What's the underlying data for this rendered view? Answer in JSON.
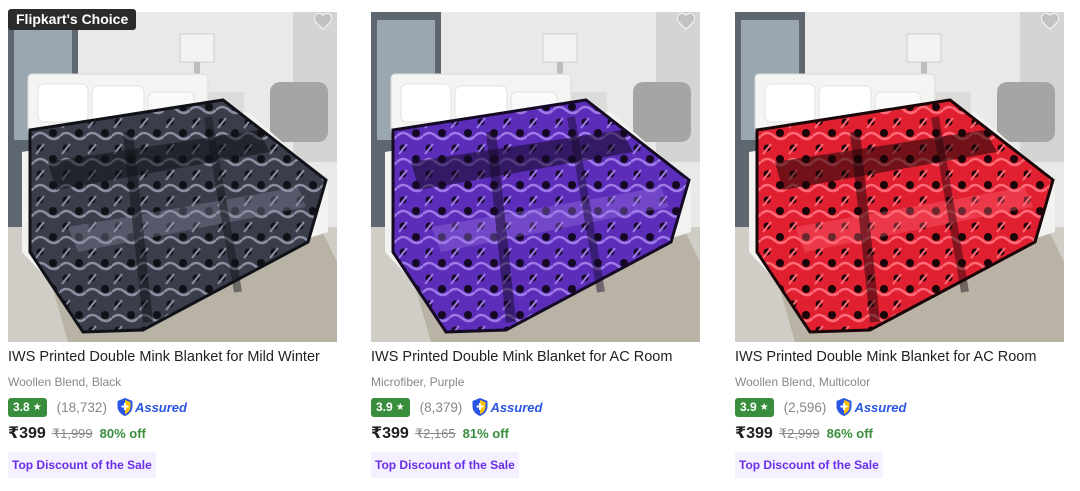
{
  "products": [
    {
      "badge": "Flipkart's Choice",
      "title": "IWS Printed Double Mink Blanket for Mild Winter",
      "subtitle": "Woollen Blend, Black",
      "rating": "3.8",
      "rating_star": "★",
      "rating_count": "(18,732)",
      "assured_label": "Assured",
      "price": "₹399",
      "mrp": "₹1,999",
      "discount": "80% off",
      "tag": "Top Discount of the Sale",
      "image": {
        "name": "blanket-black-image",
        "blanket_color": "#3a3d4a",
        "pattern_color": "#8a90a2",
        "accent_color": "#111218"
      }
    },
    {
      "badge": "",
      "title": "IWS Printed Double Mink Blanket for AC Room",
      "subtitle": "Microfiber, Purple",
      "rating": "3.9",
      "rating_star": "★",
      "rating_count": "(8,379)",
      "assured_label": "Assured",
      "price": "₹399",
      "mrp": "₹2,165",
      "discount": "81% off",
      "tag": "Top Discount of the Sale",
      "image": {
        "name": "blanket-purple-image",
        "blanket_color": "#5b2db8",
        "pattern_color": "#9d7ae8",
        "accent_color": "#140a24"
      }
    },
    {
      "badge": "",
      "title": "IWS Printed Double Mink Blanket for AC Room",
      "subtitle": "Woollen Blend, Multicolor",
      "rating": "3.9",
      "rating_star": "★",
      "rating_count": "(2,596)",
      "assured_label": "Assured",
      "price": "₹399",
      "mrp": "₹2,999",
      "discount": "86% off",
      "tag": "Top Discount of the Sale",
      "image": {
        "name": "blanket-red-image",
        "blanket_color": "#e02030",
        "pattern_color": "#ff6b78",
        "accent_color": "#1a0508"
      }
    }
  ],
  "icons": {
    "wishlist": "heart-icon",
    "assured": "shield-plus-icon",
    "star": "star-icon"
  },
  "colors": {
    "rating_green": "#388e3c",
    "assured_blue": "#2a55e5",
    "tag_purple": "#6a2ee8",
    "tag_bg": "#f5f0ff",
    "off_green": "#388e3c"
  }
}
